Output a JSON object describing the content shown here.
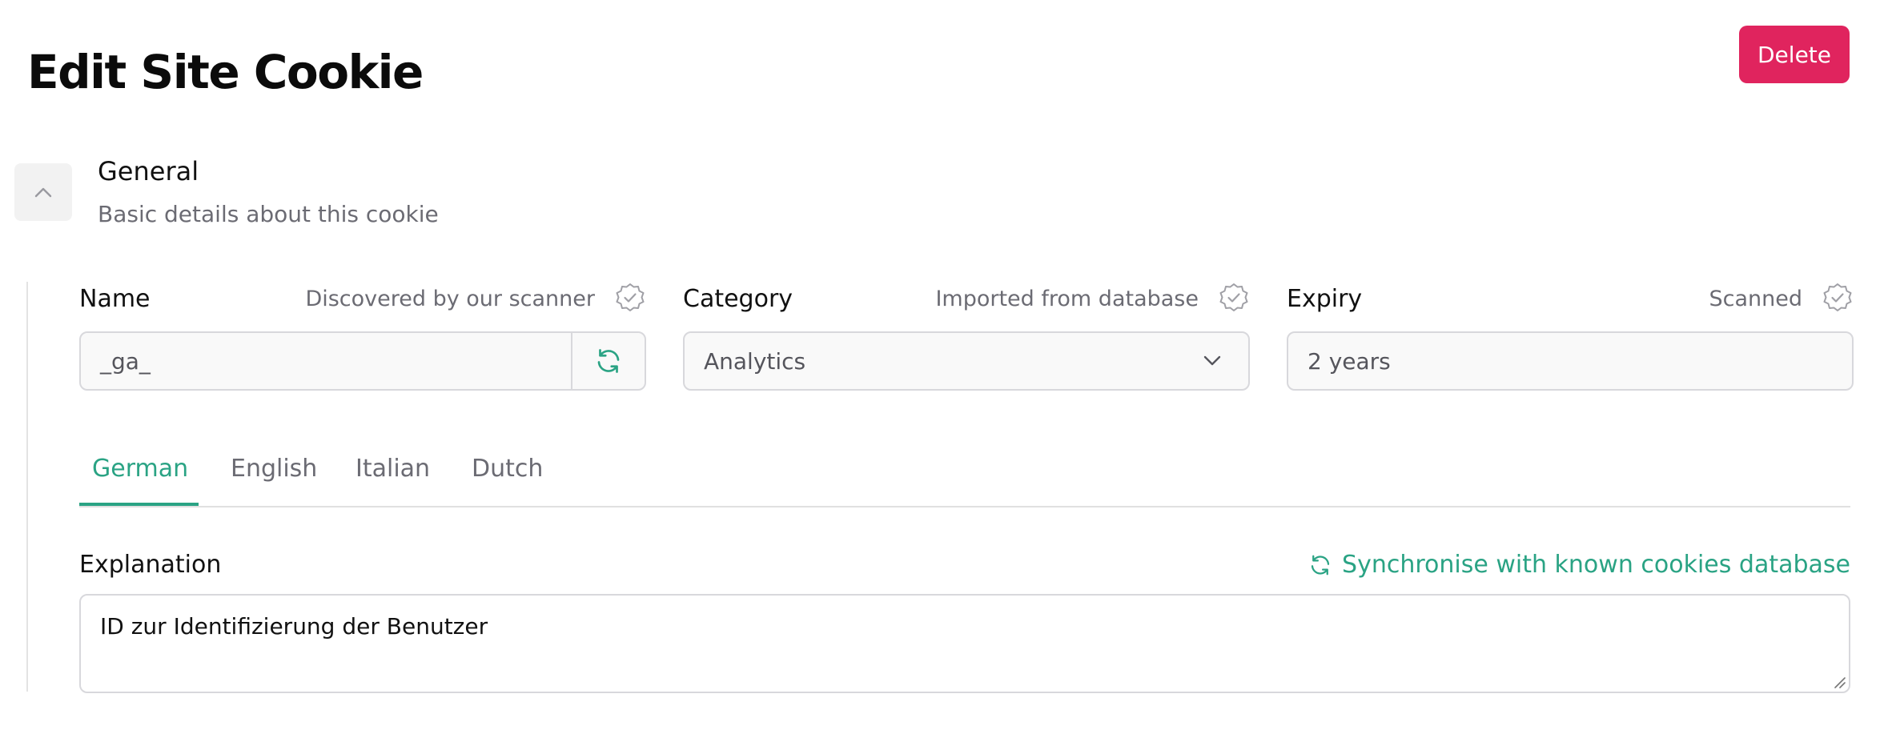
{
  "page": {
    "title": "Edit Site Cookie",
    "delete_label": "Delete"
  },
  "section": {
    "title": "General",
    "description": "Basic details about this cookie"
  },
  "fields": {
    "name": {
      "label": "Name",
      "meta": "Discovered by our scanner",
      "value": "_ga_"
    },
    "category": {
      "label": "Category",
      "meta": "Imported from database",
      "value": "Analytics"
    },
    "expiry": {
      "label": "Expiry",
      "meta": "Scanned",
      "value": "2 years"
    }
  },
  "tabs": [
    {
      "label": "German",
      "active": true
    },
    {
      "label": "English",
      "active": false
    },
    {
      "label": "Italian",
      "active": false
    },
    {
      "label": "Dutch",
      "active": false
    }
  ],
  "explanation": {
    "label": "Explanation",
    "sync_label": "Synchronise with known cookies database",
    "text": "ID zur Identifizierung der Benutzer"
  },
  "colors": {
    "accent": "#2aa384",
    "danger": "#e0245e"
  },
  "icons": {
    "collapse": "chevron-up-icon",
    "verified": "verified-badge-icon",
    "refresh": "refresh-icon",
    "dropdown": "chevron-down-icon"
  }
}
